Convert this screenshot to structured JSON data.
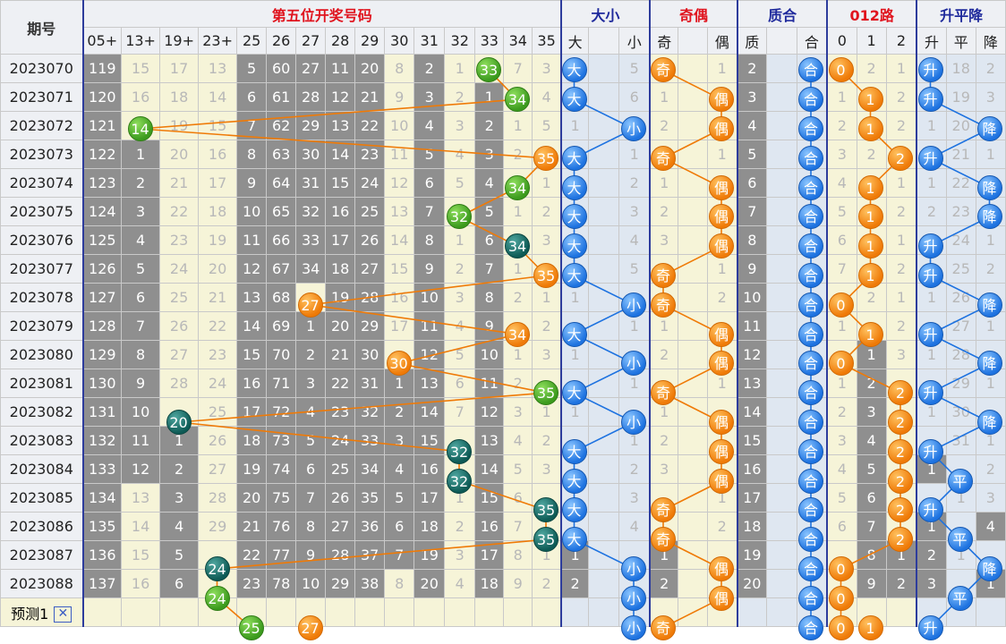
{
  "header": {
    "period_label": "期号",
    "groups": [
      "第五位开奖号码",
      "大小",
      "奇偶",
      "质合",
      "012路",
      "升平降"
    ],
    "group_colors": [
      "#e0141e",
      "#1f2a9c",
      "#e0141e",
      "#1f2a9c",
      "#e0141e",
      "#1f2a9c"
    ],
    "columns": [
      "05+",
      "13+",
      "19+",
      "23+",
      "25",
      "26",
      "27",
      "28",
      "29",
      "30",
      "31",
      "32",
      "33",
      "34",
      "35",
      "大",
      "",
      "小",
      "奇",
      "",
      "偶",
      "质",
      "",
      "合",
      "0",
      "1",
      "2",
      "升",
      "平",
      "降"
    ]
  },
  "rows": [
    {
      "period": "2023070",
      "cells": [
        "119",
        "15",
        "17",
        "13",
        "5",
        "60",
        "27",
        "11",
        "20",
        "8",
        "2",
        "1",
        "33",
        "7",
        "3",
        "大",
        "",
        "5",
        "奇",
        "",
        "1",
        "2",
        "",
        "合",
        "0",
        "2",
        "1",
        "升",
        "18",
        "2"
      ]
    },
    {
      "period": "2023071",
      "cells": [
        "120",
        "16",
        "18",
        "14",
        "6",
        "61",
        "28",
        "12",
        "21",
        "9",
        "3",
        "2",
        "1",
        "34",
        "4",
        "大",
        "",
        "6",
        "1",
        "",
        "偶",
        "3",
        "",
        "合",
        "1",
        "1",
        "2",
        "升",
        "19",
        "3"
      ]
    },
    {
      "period": "2023072",
      "cells": [
        "121",
        "14",
        "19",
        "15",
        "7",
        "62",
        "29",
        "13",
        "22",
        "10",
        "4",
        "3",
        "2",
        "1",
        "5",
        "1",
        "",
        "小",
        "2",
        "",
        "偶",
        "4",
        "",
        "合",
        "2",
        "1",
        "2",
        "1",
        "20",
        "降"
      ]
    },
    {
      "period": "2023073",
      "cells": [
        "122",
        "1",
        "20",
        "16",
        "8",
        "63",
        "30",
        "14",
        "23",
        "11",
        "5",
        "4",
        "3",
        "2",
        "35",
        "大",
        "",
        "1",
        "奇",
        "",
        "1",
        "5",
        "",
        "合",
        "3",
        "2",
        "2",
        "升",
        "21",
        "1"
      ]
    },
    {
      "period": "2023074",
      "cells": [
        "123",
        "2",
        "21",
        "17",
        "9",
        "64",
        "31",
        "15",
        "24",
        "12",
        "6",
        "5",
        "4",
        "34",
        "1",
        "大",
        "",
        "2",
        "1",
        "",
        "偶",
        "6",
        "",
        "合",
        "4",
        "1",
        "1",
        "1",
        "22",
        "降"
      ]
    },
    {
      "period": "2023075",
      "cells": [
        "124",
        "3",
        "22",
        "18",
        "10",
        "65",
        "32",
        "16",
        "25",
        "13",
        "7",
        "32",
        "5",
        "1",
        "2",
        "大",
        "",
        "3",
        "2",
        "",
        "偶",
        "7",
        "",
        "合",
        "5",
        "1",
        "2",
        "2",
        "23",
        "降"
      ]
    },
    {
      "period": "2023076",
      "cells": [
        "125",
        "4",
        "23",
        "19",
        "11",
        "66",
        "33",
        "17",
        "26",
        "14",
        "8",
        "1",
        "6",
        "34",
        "3",
        "大",
        "",
        "4",
        "3",
        "",
        "偶",
        "8",
        "",
        "合",
        "6",
        "1",
        "1",
        "升",
        "24",
        "1"
      ]
    },
    {
      "period": "2023077",
      "cells": [
        "126",
        "5",
        "24",
        "20",
        "12",
        "67",
        "34",
        "18",
        "27",
        "15",
        "9",
        "2",
        "7",
        "1",
        "35",
        "大",
        "",
        "5",
        "奇",
        "",
        "1",
        "9",
        "",
        "合",
        "7",
        "1",
        "2",
        "升",
        "25",
        "2"
      ]
    },
    {
      "period": "2023078",
      "cells": [
        "127",
        "6",
        "25",
        "21",
        "13",
        "68",
        "27",
        "19",
        "28",
        "16",
        "10",
        "3",
        "8",
        "2",
        "1",
        "1",
        "",
        "小",
        "奇",
        "",
        "2",
        "10",
        "",
        "合",
        "0",
        "2",
        "1",
        "1",
        "26",
        "降"
      ]
    },
    {
      "period": "2023079",
      "cells": [
        "128",
        "7",
        "26",
        "22",
        "14",
        "69",
        "1",
        "20",
        "29",
        "17",
        "11",
        "4",
        "9",
        "34",
        "2",
        "大",
        "",
        "1",
        "1",
        "",
        "偶",
        "11",
        "",
        "合",
        "1",
        "1",
        "2",
        "升",
        "27",
        "1"
      ]
    },
    {
      "period": "2023080",
      "cells": [
        "129",
        "8",
        "27",
        "23",
        "15",
        "70",
        "2",
        "21",
        "30",
        "30",
        "12",
        "5",
        "10",
        "1",
        "3",
        "1",
        "",
        "小",
        "2",
        "",
        "偶",
        "12",
        "",
        "合",
        "0",
        "1",
        "3",
        "1",
        "28",
        "降"
      ]
    },
    {
      "period": "2023081",
      "cells": [
        "130",
        "9",
        "28",
        "24",
        "16",
        "71",
        "3",
        "22",
        "31",
        "1",
        "13",
        "6",
        "11",
        "2",
        "35",
        "大",
        "",
        "1",
        "奇",
        "",
        "1",
        "13",
        "",
        "合",
        "1",
        "2",
        "2",
        "升",
        "29",
        "1"
      ]
    },
    {
      "period": "2023082",
      "cells": [
        "131",
        "10",
        "20",
        "25",
        "17",
        "72",
        "4",
        "23",
        "32",
        "2",
        "14",
        "7",
        "12",
        "3",
        "1",
        "1",
        "",
        "小",
        "1",
        "",
        "偶",
        "14",
        "",
        "合",
        "2",
        "3",
        "2",
        "1",
        "30",
        "降"
      ]
    },
    {
      "period": "2023083",
      "cells": [
        "132",
        "11",
        "1",
        "26",
        "18",
        "73",
        "5",
        "24",
        "33",
        "3",
        "15",
        "32",
        "13",
        "4",
        "2",
        "大",
        "",
        "1",
        "2",
        "",
        "偶",
        "15",
        "",
        "合",
        "3",
        "4",
        "2",
        "升",
        "31",
        "1"
      ]
    },
    {
      "period": "2023084",
      "cells": [
        "133",
        "12",
        "2",
        "27",
        "19",
        "74",
        "6",
        "25",
        "34",
        "4",
        "16",
        "32",
        "14",
        "5",
        "3",
        "大",
        "",
        "2",
        "3",
        "",
        "偶",
        "16",
        "",
        "合",
        "4",
        "5",
        "2",
        "1",
        "平",
        "2"
      ]
    },
    {
      "period": "2023085",
      "cells": [
        "134",
        "13",
        "3",
        "28",
        "20",
        "75",
        "7",
        "26",
        "35",
        "5",
        "17",
        "1",
        "15",
        "6",
        "35",
        "大",
        "",
        "3",
        "奇",
        "",
        "1",
        "17",
        "",
        "合",
        "5",
        "6",
        "2",
        "升",
        "1",
        "3"
      ]
    },
    {
      "period": "2023086",
      "cells": [
        "135",
        "14",
        "4",
        "29",
        "21",
        "76",
        "8",
        "27",
        "36",
        "6",
        "18",
        "2",
        "16",
        "7",
        "35",
        "大",
        "",
        "4",
        "奇",
        "",
        "2",
        "18",
        "",
        "合",
        "6",
        "7",
        "2",
        "1",
        "平",
        "4"
      ]
    },
    {
      "period": "2023087",
      "cells": [
        "136",
        "15",
        "5",
        "24",
        "22",
        "77",
        "9",
        "28",
        "37",
        "7",
        "19",
        "3",
        "17",
        "8",
        "1",
        "1",
        "",
        "小",
        "1",
        "",
        "偶",
        "19",
        "",
        "合",
        "0",
        "8",
        "1",
        "2",
        "1",
        "降"
      ]
    },
    {
      "period": "2023088",
      "cells": [
        "137",
        "16",
        "6",
        "24",
        "23",
        "78",
        "10",
        "29",
        "38",
        "8",
        "20",
        "4",
        "18",
        "9",
        "2",
        "2",
        "",
        "小",
        "2",
        "",
        "偶",
        "20",
        "",
        "合",
        "0",
        "9",
        "2",
        "3",
        "平",
        "1"
      ]
    }
  ],
  "prediction": {
    "label": "预测1",
    "close_label": "✕",
    "cells": [
      "",
      "",
      "",
      "",
      "25",
      "",
      "27",
      "",
      "",
      "",
      "",
      "",
      "",
      "",
      "",
      "",
      "",
      "小",
      "奇",
      "",
      "",
      "",
      "",
      "合",
      "0",
      "1",
      "",
      "升",
      "",
      ""
    ]
  }
}
